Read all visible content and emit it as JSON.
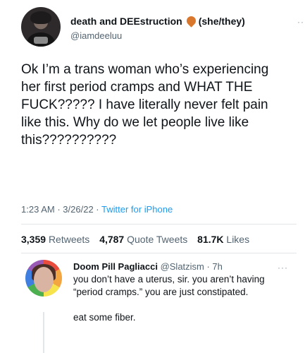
{
  "tweet": {
    "author_name": "death and DEEstruction",
    "pronouns": "(she/they)",
    "handle": "@iamdeeluu",
    "more_icon": "···",
    "text": "Ok I’m a trans woman who’s experiencing her first period cramps and WHAT THE FUCK????? I have literally never felt pain like this. Why do we let people live like this??????????",
    "time": "1:23 AM",
    "date": "3/26/22",
    "separator": "·",
    "client": "Twitter for iPhone",
    "stats": {
      "retweets_count": "3,359",
      "retweets_label": "Retweets",
      "quotes_count": "4,787",
      "quotes_label": "Quote Tweets",
      "likes_count": "81.7K",
      "likes_label": "Likes"
    }
  },
  "reply": {
    "author_name": "Doom Pill Pagliacci",
    "meta": "@Slatzism · 7h",
    "more_icon": "···",
    "text": "you don’t have a uterus, sir. you aren’t having “period cramps.” you are just constipated.\n\neat some fiber."
  }
}
